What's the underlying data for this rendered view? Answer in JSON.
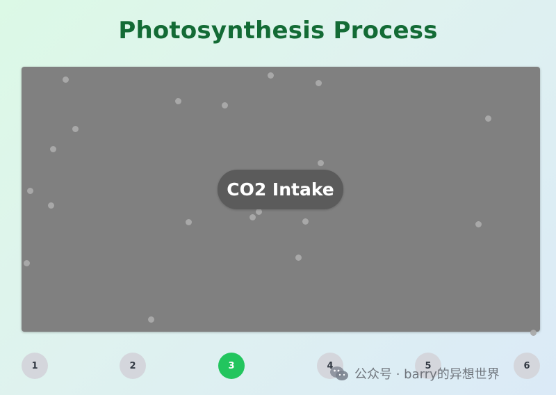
{
  "title": "Photosynthesis Process",
  "stage": {
    "current_step_label": "CO2 Intake"
  },
  "steps": [
    {
      "label": "1",
      "active": false
    },
    {
      "label": "2",
      "active": false
    },
    {
      "label": "3",
      "active": true
    },
    {
      "label": "4",
      "active": false
    },
    {
      "label": "5",
      "active": false
    },
    {
      "label": "6",
      "active": false
    }
  ],
  "watermark": {
    "text": "公众号 · barry的异想世界",
    "icon": "wechat-icon"
  },
  "colors": {
    "title": "#136b35",
    "stage_bg": "#808080",
    "particle": "#aaaaaa",
    "active_step": "#22c55e",
    "inactive_step": "#d4d6dc"
  }
}
